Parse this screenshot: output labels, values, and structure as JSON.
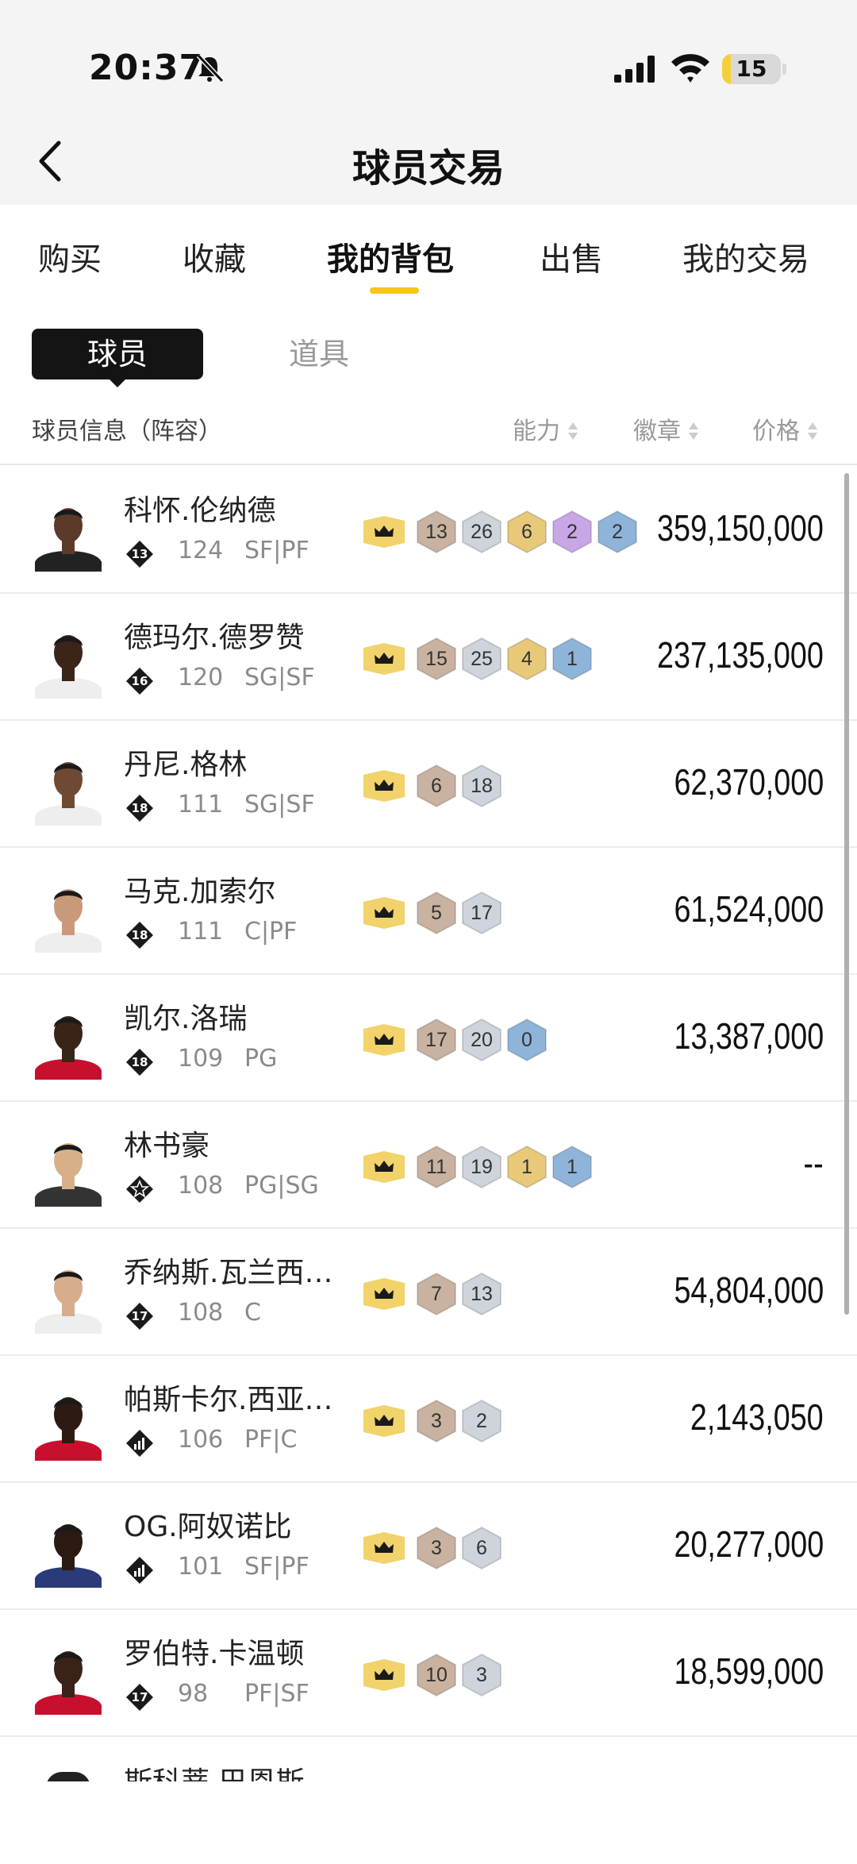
{
  "status_bar": {
    "time": "20:37",
    "battery": "15",
    "battery_level": 0.15
  },
  "header": {
    "title": "球员交易"
  },
  "tabs": [
    {
      "label": "购买",
      "active": false
    },
    {
      "label": "收藏",
      "active": false
    },
    {
      "label": "我的背包",
      "active": true
    },
    {
      "label": "出售",
      "active": false
    },
    {
      "label": "我的交易",
      "active": false
    }
  ],
  "segments": {
    "active": "球员",
    "inactive": "道具"
  },
  "columns": {
    "info": "球员信息（阵容）",
    "ability": "能力",
    "badges": "徽章",
    "price": "价格"
  },
  "players": [
    {
      "name": "科怀.伦纳德",
      "tier": "13",
      "ovr": "124",
      "pos": "SF|PF",
      "price": "359,150,000",
      "badges": [
        {
          "n": "13",
          "c": "bronze"
        },
        {
          "n": "26",
          "c": "silver"
        },
        {
          "n": "6",
          "c": "gold"
        },
        {
          "n": "2",
          "c": "purple"
        },
        {
          "n": "2",
          "c": "blue"
        }
      ]
    },
    {
      "name": "德玛尔.德罗赞",
      "tier": "16",
      "ovr": "120",
      "pos": "SG|SF",
      "price": "237,135,000",
      "badges": [
        {
          "n": "15",
          "c": "bronze"
        },
        {
          "n": "25",
          "c": "silver"
        },
        {
          "n": "4",
          "c": "gold"
        },
        {
          "n": "1",
          "c": "blue"
        }
      ]
    },
    {
      "name": "丹尼.格林",
      "tier": "18",
      "ovr": "111",
      "pos": "SG|SF",
      "price": "62,370,000",
      "badges": [
        {
          "n": "6",
          "c": "bronze"
        },
        {
          "n": "18",
          "c": "silver"
        }
      ]
    },
    {
      "name": "马克.加索尔",
      "tier": "18",
      "ovr": "111",
      "pos": "C|PF",
      "price": "61,524,000",
      "badges": [
        {
          "n": "5",
          "c": "bronze"
        },
        {
          "n": "17",
          "c": "silver"
        }
      ]
    },
    {
      "name": "凯尔.洛瑞",
      "tier": "18",
      "ovr": "109",
      "pos": "PG",
      "price": "13,387,000",
      "badges": [
        {
          "n": "17",
          "c": "bronze"
        },
        {
          "n": "20",
          "c": "silver"
        },
        {
          "n": "0",
          "c": "blue"
        }
      ]
    },
    {
      "name": "林书豪",
      "tier": "star",
      "ovr": "108",
      "pos": "PG|SG",
      "price": "--",
      "badges": [
        {
          "n": "11",
          "c": "bronze"
        },
        {
          "n": "19",
          "c": "silver"
        },
        {
          "n": "1",
          "c": "gold"
        },
        {
          "n": "1",
          "c": "blue"
        }
      ]
    },
    {
      "name": "乔纳斯.瓦兰西…",
      "tier": "17",
      "ovr": "108",
      "pos": "C",
      "price": "54,804,000",
      "badges": [
        {
          "n": "7",
          "c": "bronze"
        },
        {
          "n": "13",
          "c": "silver"
        }
      ]
    },
    {
      "name": "帕斯卡尔.西亚…",
      "tier": "bars",
      "ovr": "106",
      "pos": "PF|C",
      "price": "2,143,050",
      "badges": [
        {
          "n": "3",
          "c": "bronze"
        },
        {
          "n": "2",
          "c": "silver"
        }
      ]
    },
    {
      "name": "OG.阿奴诺比",
      "tier": "bars",
      "ovr": "101",
      "pos": "SF|PF",
      "price": "20,277,000",
      "badges": [
        {
          "n": "3",
          "c": "bronze"
        },
        {
          "n": "6",
          "c": "silver"
        }
      ]
    },
    {
      "name": "罗伯特.卡温顿",
      "tier": "17",
      "ovr": "98",
      "pos": "PF|SF",
      "price": "18,599,000",
      "badges": [
        {
          "n": "10",
          "c": "bronze"
        },
        {
          "n": "3",
          "c": "silver"
        }
      ]
    }
  ],
  "partial_player": {
    "name": "斯科蒂.巴恩斯"
  },
  "colors": {
    "accent": "#f5c518",
    "bronze": "#c9b3a0",
    "silver": "#cfd4dc",
    "gold": "#e8c97a",
    "purple": "#c9a6e6",
    "blue": "#8fb4d9"
  }
}
